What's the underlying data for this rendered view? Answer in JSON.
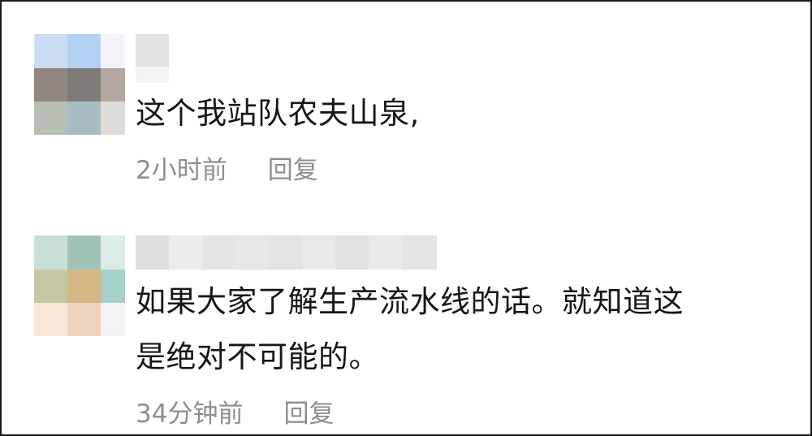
{
  "comments": [
    {
      "text": "这个我站队农夫山泉,",
      "time": "2小时前",
      "reply_label": "回复",
      "avatar_colors": [
        "#c9dcf3",
        "#b3d2f3",
        "#f3f5fb",
        "#928780",
        "#7f7b79",
        "#b4a7a2",
        "#b7bfb5",
        "#a8bcc4",
        "#dedcd7"
      ]
    },
    {
      "text": "如果大家了解生产流水线的话。就知道这\n是绝对不可能的。",
      "time": "34分钟前",
      "reply_label": "回复",
      "avatar_colors": [
        "#c8dfd7",
        "#9fc4b7",
        "#daece5",
        "#c5c7a4",
        "#d3b985",
        "#a6d0c9",
        "#fbe6da",
        "#f0d4c0",
        "#f2f4f2"
      ]
    }
  ]
}
